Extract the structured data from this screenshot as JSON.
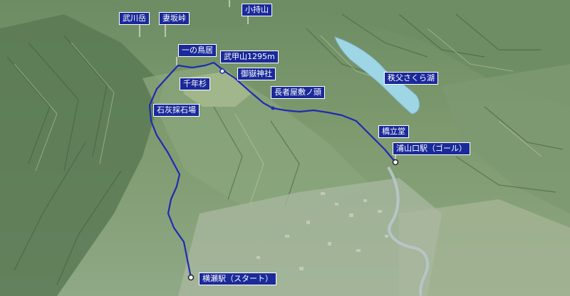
{
  "colors": {
    "route": "#1f2bb0",
    "label_bg": "#1a2a9a",
    "label_text": "#ffffff",
    "lake": "#9fd6e6"
  },
  "labels": {
    "takegawa_dake": "武川岳",
    "tsumasaka_toge": "妻坂峠",
    "komochi_yama": "小持山",
    "ichi_no_torii": "一の鳥居",
    "bukosan": "武甲山1295m",
    "ontake_jinja": "御嶽神社",
    "sennen_sugi": "千年杉",
    "chichibu_sakura_ko": "秩父さくら湖",
    "choja_yashiki": "長者屋敷ノ頭",
    "sekkai_saisekijo": "石灰採石場",
    "tachibana_do": "橋立堂",
    "urayamaguchi_eki": "浦山口駅（ゴール）",
    "yokoze_eki": "横瀬駅（スタート）"
  }
}
